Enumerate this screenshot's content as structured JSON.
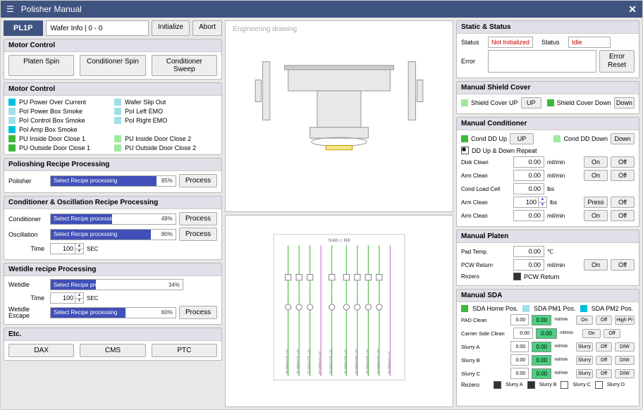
{
  "title": "Polisher Manual",
  "topbar": {
    "tag": "PL1P",
    "wafer": "Wafer Info | 0 - 0",
    "init": "Initialize",
    "abort": "Abort"
  },
  "motor1": {
    "title": "Motor Control",
    "b1": "Platen Spin",
    "b2": "Conditioner Spin",
    "b3": "Conditioner Sweep"
  },
  "motor2": {
    "title": "Motor Control",
    "items": [
      {
        "c": "cyan",
        "t": "PU Power Over Current"
      },
      {
        "c": "lcyan",
        "t": "Wafer Slip Out"
      },
      {
        "c": "lcyan",
        "t": "PoI Power Box Smoke"
      },
      {
        "c": "lcyan",
        "t": "PoI Left EMO"
      },
      {
        "c": "lcyan",
        "t": "PoI Control Box Smoke"
      },
      {
        "c": "lcyan",
        "t": "PoI Right EMO"
      },
      {
        "c": "cyan",
        "t": "PoI Amp Box Smoke"
      },
      {
        "c": "",
        "t": ""
      },
      {
        "c": "green",
        "t": "PU Inside Door Close 1"
      },
      {
        "c": "lgreen",
        "t": "PU Inside Door Close 2"
      },
      {
        "c": "green",
        "t": "PU Outside Door Close 1"
      },
      {
        "c": "lgreen",
        "t": "PU Outside Door Close 2"
      }
    ]
  },
  "polish": {
    "title": "Polioshing Recipe Processing",
    "label": "Polisher",
    "text": "Select Recipe processing",
    "pct": "85%",
    "btn": "Process"
  },
  "cond": {
    "title": "Conditioner & Oscillation Recipe Processing",
    "r1_label": "Conditioner",
    "r1_text": "Select Recipe processing",
    "r1_pct": "49%",
    "r1_btn": "Process",
    "r2_label": "Oscillation",
    "r2_text": "Select Recipe processing",
    "r2_pct": "80%",
    "r2_btn": "Process",
    "time_label": "Time",
    "time_val": "100",
    "time_unit": "SEC"
  },
  "wet": {
    "title": "Wetidle recipe Processing",
    "r1_label": "Wetidle",
    "r1_text": "Select Recipe processing",
    "r1_pct": "34%",
    "time_label": "Time",
    "time_val": "100",
    "time_unit": "SEC",
    "r2_label": "Wetidle Escape",
    "r2_text": "Select Recipe processing",
    "r2_pct": "60%",
    "r2_btn": "Process"
  },
  "etc": {
    "title": "Etc.",
    "b1": "DAX",
    "b2": "CMS",
    "b3": "PTC"
  },
  "drawing_label": "Engineering drawing",
  "static": {
    "title": "Static & Status",
    "status_l": "Status",
    "status_v": "Not Initialized",
    "status_l2": "Status",
    "status_v2": "Idle",
    "error_l": "Error",
    "reset": "Error Reset"
  },
  "shield": {
    "title": "Manual Shield Cover",
    "up_l": "Shield Cover UP",
    "up_b": "UP",
    "down_l": "Shield Cover Down",
    "down_b": "Down"
  },
  "mcond": {
    "title": "Manual Conditioner",
    "up_l": "Cond DD Up",
    "up_b": "UP",
    "down_l": "Cond DD Down",
    "down_b": "Down",
    "repeat": "DD Up & Down Repeat",
    "rows": [
      {
        "l": "Disk Clean",
        "v": "0.00",
        "u": "mil/min",
        "b1": "On",
        "b2": "Off"
      },
      {
        "l": "Arm Clean",
        "v": "0.00",
        "u": "mil/min",
        "b1": "On",
        "b2": "Off"
      },
      {
        "l": "Cond Load Cell",
        "v": "0.00",
        "u": "lbs"
      },
      {
        "l": "Arm Clean",
        "v": "100",
        "u": "lbs",
        "b1": "Press",
        "b2": "Off",
        "spin": true
      },
      {
        "l": "Arm Clean",
        "v": "0.00",
        "u": "mil/min",
        "b1": "On",
        "b2": "Off"
      }
    ]
  },
  "platen": {
    "title": "Manual Platen",
    "pad_l": "Pad Temp.",
    "pad_v": "0.00",
    "pad_u": "℃",
    "pcw_l": "PCW Return",
    "pcw_v": "0.00",
    "pcw_u": "mil/min",
    "on": "On",
    "off": "Off",
    "rez_l": "Rezero",
    "rez_chk": "PCW Return"
  },
  "sda": {
    "title": "Manual SDA",
    "home": "SDA Home Pos.",
    "pm1": "SDA PM1 Pos.",
    "pm2": "SDA PM2 Pos.",
    "rows": [
      {
        "l": "PAD Clean",
        "v1": "0.00",
        "v2": "0.00",
        "u": "mil/min",
        "b1": "On",
        "b2": "Off",
        "b3": "High Pr"
      },
      {
        "l": "Carrier Side Clean",
        "v1": "0.00",
        "v2": "0.00",
        "u": "mil/min",
        "b1": "On",
        "b2": "Off"
      },
      {
        "l": "Slurry A",
        "v1": "0.00",
        "v2": "0.00",
        "u": "mil/min",
        "b1": "Slurry",
        "b2": "Off",
        "b3": "DIW"
      },
      {
        "l": "Slurry B",
        "v1": "0.00",
        "v2": "0.00",
        "u": "mil/min",
        "b1": "Slurry",
        "b2": "Off",
        "b3": "DIW"
      },
      {
        "l": "Slurry C",
        "v1": "0.00",
        "v2": "0.00",
        "u": "mil/min",
        "b1": "Slurry",
        "b2": "Off",
        "b3": "DIW"
      }
    ],
    "rez_l": "Rezero",
    "r1": "Slurry A",
    "r2": "Slurry B",
    "r3": "Slurry C",
    "r4": "Slurry D"
  }
}
